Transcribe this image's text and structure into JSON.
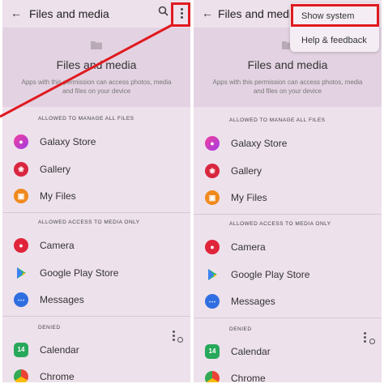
{
  "screen": {
    "title": "Files and media",
    "banner_title": "Files and media",
    "banner_desc_left": "Apps with this permission can access photos, media and files on your device",
    "banner_desc_right": "Apps with this permission can access photos, media and files on your device"
  },
  "sections": {
    "manage_all": "ALLOWED TO MANAGE ALL FILES",
    "media_only": "ALLOWED ACCESS TO MEDIA ONLY",
    "denied": "DENIED"
  },
  "apps": {
    "galaxy_store": "Galaxy Store",
    "gallery": "Gallery",
    "my_files": "My Files",
    "camera": "Camera",
    "play_store": "Google Play Store",
    "messages": "Messages",
    "calendar": "Calendar",
    "chrome": "Chrome"
  },
  "menu": {
    "show_system": "Show system",
    "help_feedback": "Help & feedback"
  },
  "colors": {
    "highlight": "#e01a1f",
    "panel_bg": "#ede1ec",
    "banner_bg": "#e3d3e2"
  }
}
